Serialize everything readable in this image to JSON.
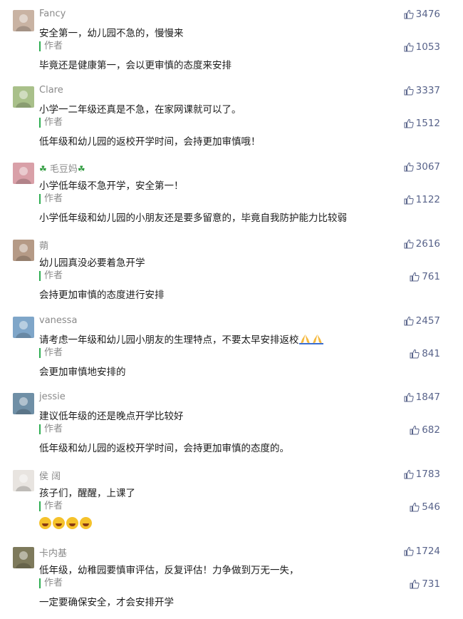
{
  "comments": [
    {
      "nick": "Fancy",
      "text": "安全第一，幼儿园不急的，慢慢来",
      "likes": "3476",
      "author_label": "作者",
      "reply": "毕竟还是健康第一，会以更审慎的态度来安排",
      "reply_likes": "1053",
      "avatar_color": "#c9b3a3"
    },
    {
      "nick": "Clare",
      "text": "小学一二年级还真是不急，在家网课就可以了。",
      "likes": "3337",
      "author_label": "作者",
      "reply": "低年级和幼儿园的返校开学时间，会持更加审慎哦！",
      "reply_likes": "1512",
      "avatar_color": "#a9c08a"
    },
    {
      "nick": "毛豆妈",
      "text": "小学低年级不急开学，安全第一！",
      "likes": "3067",
      "author_label": "作者",
      "reply": "小学低年级和幼儿园的小朋友还是要多留意的，毕竟自我防护能力比较弱",
      "reply_likes": "1122",
      "avatar_color": "#d9a0a8"
    },
    {
      "nick": "蒴",
      "text": "幼儿园真没必要着急开学",
      "likes": "2616",
      "author_label": "作者",
      "reply": "会持更加审慎的态度进行安排",
      "reply_likes": "761",
      "avatar_color": "#b59a86"
    },
    {
      "nick": "vanessa",
      "text": "请考虑一年级和幼儿园小朋友的生理特点，不要太早安排返校",
      "likes": "2457",
      "author_label": "作者",
      "reply": "会更加审慎地安排的",
      "reply_likes": "841",
      "avatar_color": "#7fa6c9"
    },
    {
      "nick": "jessie",
      "text": "建议低年级的还是晚点开学比较好",
      "likes": "1847",
      "author_label": "作者",
      "reply": "低年级和幼儿园的返校开学时间，会持更加审慎的态度的。",
      "reply_likes": "682",
      "avatar_color": "#6f8fa6"
    },
    {
      "nick": "侯 阔",
      "text": "孩子们，醒醒，上课了",
      "likes": "1783",
      "author_label": "作者",
      "reply": "",
      "reply_likes": "546",
      "avatar_color": "#e8e4e0"
    },
    {
      "nick": "卡内基",
      "text": "低年级，幼稚园要慎审评估，反复评估！力争做到万无一失，",
      "likes": "1724",
      "author_label": "作者",
      "reply": "一定要确保安全，才会安排开学",
      "reply_likes": "731",
      "avatar_color": "#7e7a5c"
    }
  ],
  "icons": {
    "like": "thumb-up-icon",
    "clover": "clover-icon",
    "laugh": "laughing-emoji-icon",
    "pray": "praying-hands-emoji-icon"
  },
  "colors": {
    "author_bar": "#2fae52",
    "like_text": "#58638a",
    "nick": "#8a8a8a"
  }
}
